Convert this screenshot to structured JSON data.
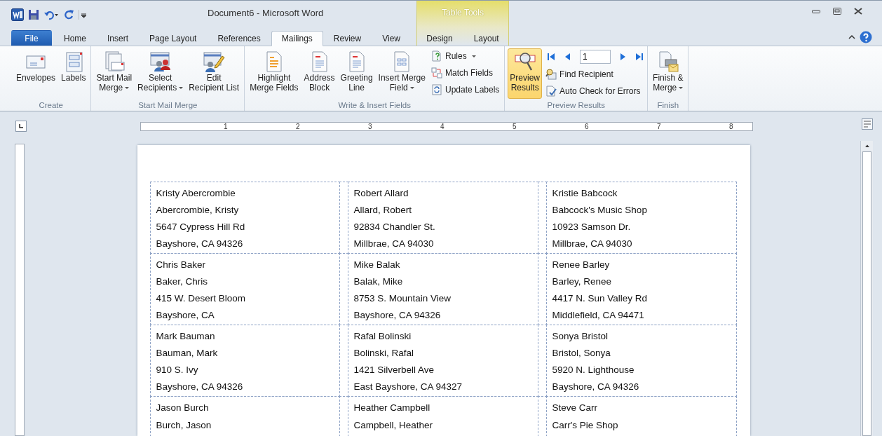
{
  "window": {
    "title": "Document6 - Microsoft Word",
    "context_title": "Table Tools"
  },
  "tabs": [
    {
      "label": "File",
      "kind": "file",
      "selected": false
    },
    {
      "label": "Home",
      "kind": "normal",
      "selected": false
    },
    {
      "label": "Insert",
      "kind": "normal",
      "selected": false
    },
    {
      "label": "Page Layout",
      "kind": "normal",
      "selected": false
    },
    {
      "label": "References",
      "kind": "normal",
      "selected": false
    },
    {
      "label": "Mailings",
      "kind": "normal",
      "selected": true
    },
    {
      "label": "Review",
      "kind": "normal",
      "selected": false
    },
    {
      "label": "View",
      "kind": "normal",
      "selected": false
    },
    {
      "label": "Design",
      "kind": "context",
      "selected": false
    },
    {
      "label": "Layout",
      "kind": "context",
      "selected": false
    }
  ],
  "ribbon": [
    {
      "name": "Create",
      "kind": "plain",
      "items": [
        {
          "kind": "large",
          "label": "Envelopes",
          "dropdown": false
        },
        {
          "kind": "large",
          "label": "Labels",
          "dropdown": false
        }
      ]
    },
    {
      "name": "Start Mail Merge",
      "kind": "plain",
      "items": [
        {
          "kind": "large",
          "label": "Start Mail\nMerge",
          "dropdown": true
        },
        {
          "kind": "large",
          "label": "Select\nRecipients",
          "dropdown": true
        },
        {
          "kind": "large",
          "label": "Edit\nRecipient List",
          "dropdown": false
        }
      ]
    },
    {
      "name": "Write & Insert Fields",
      "kind": "plain",
      "items": [
        {
          "kind": "large",
          "label": "Highlight\nMerge Fields",
          "dropdown": false
        },
        {
          "kind": "large",
          "label": "Address\nBlock",
          "dropdown": false
        },
        {
          "kind": "large",
          "label": "Greeting\nLine",
          "dropdown": false
        },
        {
          "kind": "large",
          "label": "Insert Merge\nField",
          "dropdown": true
        },
        {
          "kind": "small",
          "label": "Rules",
          "dropdown": true
        },
        {
          "kind": "small",
          "label": "Match Fields",
          "dropdown": false
        },
        {
          "kind": "small",
          "label": "Update Labels",
          "dropdown": false
        }
      ]
    },
    {
      "name": "Preview Results",
      "kind": "nav",
      "record": "1",
      "items": [
        {
          "kind": "toggle",
          "label": "Preview\nResults",
          "dropdown": false,
          "on": true
        },
        {
          "kind": "small",
          "label": "Find Recipient",
          "dropdown": false
        },
        {
          "kind": "small",
          "label": "Auto Check for Errors",
          "dropdown": false
        }
      ]
    },
    {
      "name": "Finish",
      "kind": "plain",
      "items": [
        {
          "kind": "large",
          "label": "Finish &\nMerge",
          "dropdown": true
        }
      ]
    }
  ],
  "ruler": {
    "numbers": [
      "1",
      "2",
      "3",
      "4",
      "5",
      "6",
      "7",
      "8"
    ]
  },
  "labels": [
    [
      [
        "Kristy Abercrombie",
        "Abercrombie, Kristy",
        "5647  Cypress Hill Rd",
        "Bayshore, CA 94326"
      ],
      [
        "Robert Allard",
        "Allard, Robert",
        "92834  Chandler St.",
        "Millbrae, CA 94030"
      ],
      [
        "Kristie Babcock",
        "Babcock's Music Shop",
        "10923  Samson Dr.",
        "Millbrae, CA 94030"
      ]
    ],
    [
      [
        "Chris Baker",
        "Baker, Chris",
        "415  W. Desert Bloom",
        "Bayshore, CA"
      ],
      [
        "Mike Balak",
        "Balak, Mike",
        "8753  S. Mountain View",
        "Bayshore, CA 94326"
      ],
      [
        "Renee Barley",
        "Barley, Renee",
        "4417  N. Sun Valley Rd",
        "Middlefield, CA 94471"
      ]
    ],
    [
      [
        "Mark Bauman",
        "Bauman, Mark",
        "910  S. Ivy",
        "Bayshore, CA 94326"
      ],
      [
        "Rafal Bolinski",
        "Bolinski, Rafal",
        "1421  Silverbell Ave",
        "East Bayshore, CA 94327"
      ],
      [
        "Sonya Bristol",
        "Bristol, Sonya",
        "5920  N. Lighthouse",
        "Bayshore, CA 94326"
      ]
    ],
    [
      [
        "Jason Burch",
        "Burch, Jason"
      ],
      [
        "Heather Campbell",
        "Campbell, Heather"
      ],
      [
        "Steve Carr",
        "Carr's Pie Shop"
      ]
    ]
  ]
}
